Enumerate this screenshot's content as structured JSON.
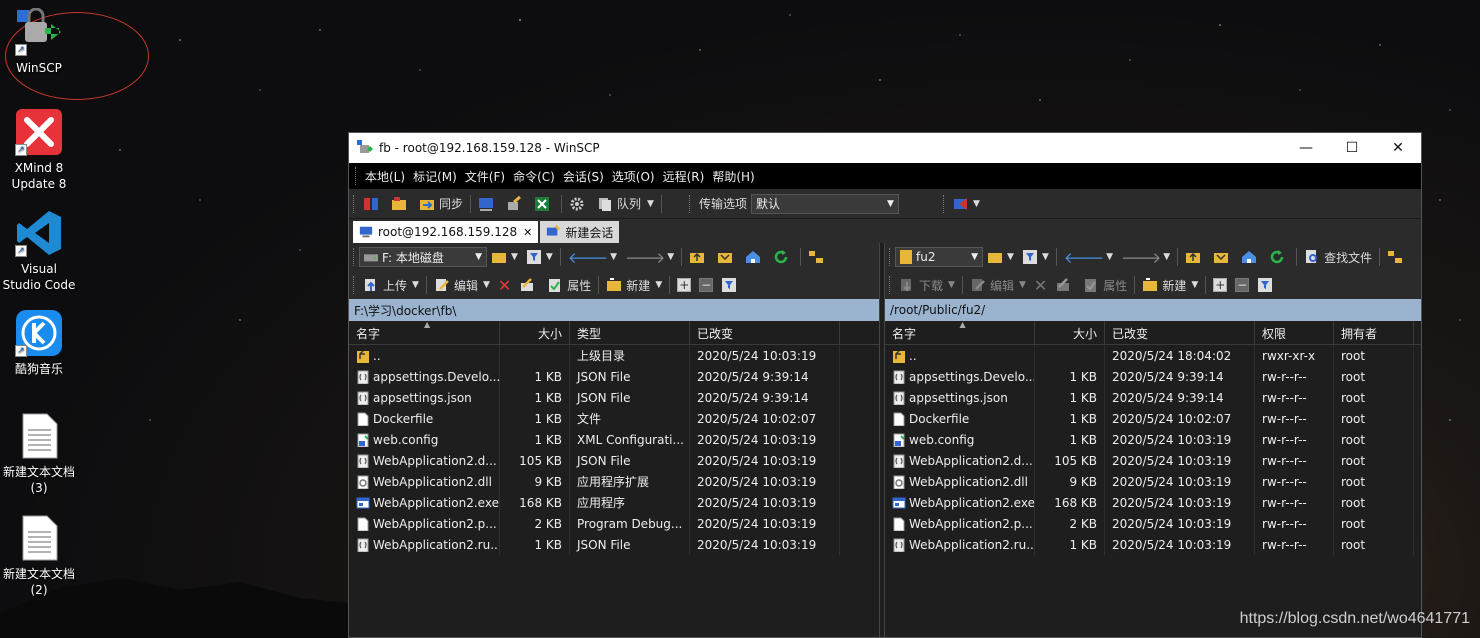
{
  "desktop": {
    "icons": [
      {
        "label": "WinSCP"
      },
      {
        "label": "XMind 8\nUpdate 8"
      },
      {
        "label": "Visual\nStudio Code"
      },
      {
        "label": "酷狗音乐"
      },
      {
        "label": "新建文本文档\n(3)"
      },
      {
        "label": "新建文本文档\n(2)"
      }
    ]
  },
  "window": {
    "title": "fb - root@192.168.159.128 - WinSCP",
    "controls": {
      "minimize": "—",
      "maximize": "☐",
      "close": "✕"
    }
  },
  "menu": [
    "本地(L)",
    "标记(M)",
    "文件(F)",
    "命令(C)",
    "会话(S)",
    "选项(O)",
    "远程(R)",
    "帮助(H)"
  ],
  "toolbar": {
    "sync_label": "同步",
    "queue_label": "队列",
    "transfer_options_label": "传输选项",
    "transfer_preset": "默认"
  },
  "tabs": {
    "session": "root@192.168.159.128",
    "new_session": "新建会话"
  },
  "left": {
    "drive": "F: 本地磁盘",
    "actions": {
      "upload": "上传",
      "edit": "编辑",
      "properties": "属性",
      "new": "新建"
    },
    "path": "F:\\学习\\docker\\fb\\",
    "columns": [
      "名字",
      "大小",
      "类型",
      "已改变"
    ],
    "files": [
      {
        "name": "..",
        "size": "",
        "type": "上级目录",
        "modified": "2020/5/24  10:03:19",
        "icon": "parent"
      },
      {
        "name": "appsettings.Develo...",
        "size": "1 KB",
        "type": "JSON File",
        "modified": "2020/5/24  9:39:14",
        "icon": "json"
      },
      {
        "name": "appsettings.json",
        "size": "1 KB",
        "type": "JSON File",
        "modified": "2020/5/24  9:39:14",
        "icon": "json"
      },
      {
        "name": "Dockerfile",
        "size": "1 KB",
        "type": "文件",
        "modified": "2020/5/24  10:02:07",
        "icon": "file"
      },
      {
        "name": "web.config",
        "size": "1 KB",
        "type": "XML Configurati...",
        "modified": "2020/5/24  10:03:19",
        "icon": "config"
      },
      {
        "name": "WebApplication2.d...",
        "size": "105 KB",
        "type": "JSON File",
        "modified": "2020/5/24  10:03:19",
        "icon": "json"
      },
      {
        "name": "WebApplication2.dll",
        "size": "9 KB",
        "type": "应用程序扩展",
        "modified": "2020/5/24  10:03:19",
        "icon": "dll"
      },
      {
        "name": "WebApplication2.exe",
        "size": "168 KB",
        "type": "应用程序",
        "modified": "2020/5/24  10:03:19",
        "icon": "exe"
      },
      {
        "name": "WebApplication2.p...",
        "size": "2 KB",
        "type": "Program Debug...",
        "modified": "2020/5/24  10:03:19",
        "icon": "file"
      },
      {
        "name": "WebApplication2.ru...",
        "size": "1 KB",
        "type": "JSON File",
        "modified": "2020/5/24  10:03:19",
        "icon": "json"
      }
    ]
  },
  "right": {
    "dir": "fu2",
    "find_files_label": "查找文件",
    "actions": {
      "download": "下载",
      "edit": "编辑",
      "properties": "属性",
      "new": "新建"
    },
    "path": "/root/Public/fu2/",
    "columns": [
      "名字",
      "大小",
      "已改变",
      "权限",
      "拥有者"
    ],
    "files": [
      {
        "name": "..",
        "size": "",
        "modified": "2020/5/24 18:04:02",
        "perms": "rwxr-xr-x",
        "owner": "root",
        "icon": "parent"
      },
      {
        "name": "appsettings.Develo...",
        "size": "1 KB",
        "modified": "2020/5/24 9:39:14",
        "perms": "rw-r--r--",
        "owner": "root",
        "icon": "json"
      },
      {
        "name": "appsettings.json",
        "size": "1 KB",
        "modified": "2020/5/24 9:39:14",
        "perms": "rw-r--r--",
        "owner": "root",
        "icon": "json"
      },
      {
        "name": "Dockerfile",
        "size": "1 KB",
        "modified": "2020/5/24 10:02:07",
        "perms": "rw-r--r--",
        "owner": "root",
        "icon": "file"
      },
      {
        "name": "web.config",
        "size": "1 KB",
        "modified": "2020/5/24 10:03:19",
        "perms": "rw-r--r--",
        "owner": "root",
        "icon": "config"
      },
      {
        "name": "WebApplication2.d...",
        "size": "105 KB",
        "modified": "2020/5/24 10:03:19",
        "perms": "rw-r--r--",
        "owner": "root",
        "icon": "json"
      },
      {
        "name": "WebApplication2.dll",
        "size": "9 KB",
        "modified": "2020/5/24 10:03:19",
        "perms": "rw-r--r--",
        "owner": "root",
        "icon": "dll"
      },
      {
        "name": "WebApplication2.exe",
        "size": "168 KB",
        "modified": "2020/5/24 10:03:19",
        "perms": "rw-r--r--",
        "owner": "root",
        "icon": "exe"
      },
      {
        "name": "WebApplication2.p...",
        "size": "2 KB",
        "modified": "2020/5/24 10:03:19",
        "perms": "rw-r--r--",
        "owner": "root",
        "icon": "file"
      },
      {
        "name": "WebApplication2.ru...",
        "size": "1 KB",
        "modified": "2020/5/24 10:03:19",
        "perms": "rw-r--r--",
        "owner": "root",
        "icon": "json"
      }
    ]
  },
  "watermark": "https://blog.csdn.net/wo4641771"
}
